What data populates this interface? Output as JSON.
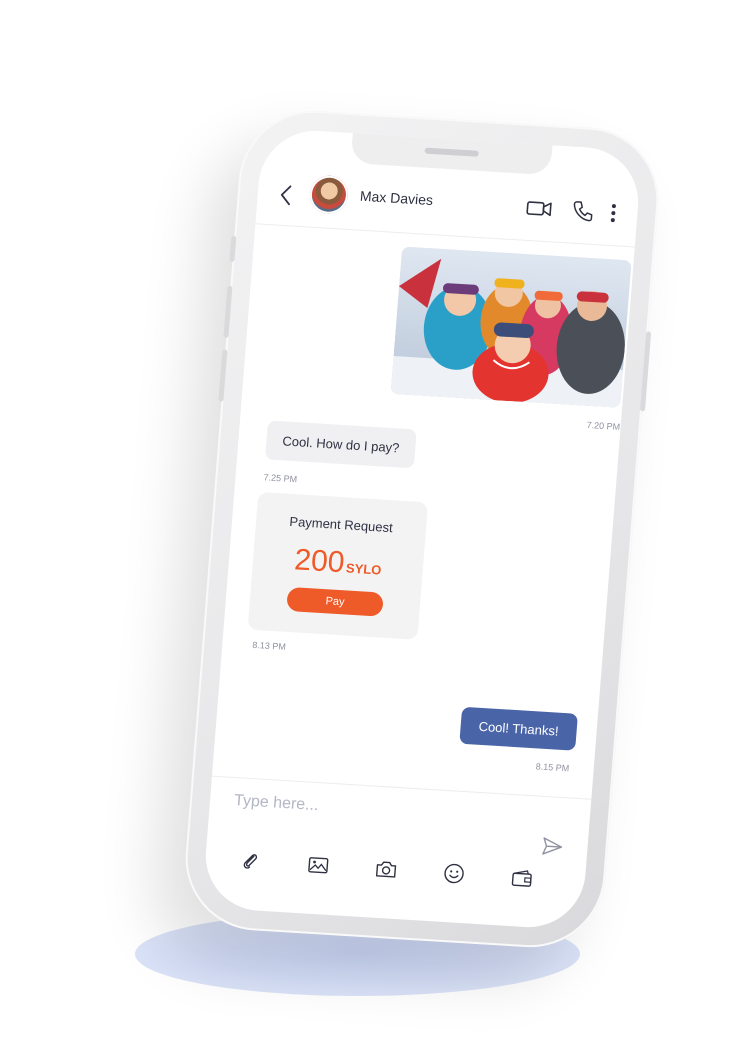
{
  "contact": {
    "name": "Max Davies"
  },
  "messages": {
    "photo_time": "7.20 PM",
    "question_text": "Cool. How do I pay?",
    "question_time": "7.25 PM",
    "payment": {
      "title": "Payment Request",
      "amount": "200",
      "currency": "SYLO",
      "button_label": "Pay",
      "time": "8.13 PM"
    },
    "reply_text": "Cool! Thanks!",
    "reply_time": "8.15 PM"
  },
  "composer": {
    "placeholder": "Type here..."
  },
  "icons": {
    "back": "chevron-left-icon",
    "video": "video-camera-icon",
    "call": "phone-icon",
    "more": "more-vertical-icon",
    "send": "send-icon",
    "attach": "paperclip-icon",
    "gallery": "image-icon",
    "camera": "camera-icon",
    "emoji": "smiley-icon",
    "wallet": "wallet-icon"
  },
  "colors": {
    "accent_orange": "#ef5a29",
    "outgoing_bubble": "#4a64a8",
    "incoming_bubble": "#f0f0f2"
  }
}
